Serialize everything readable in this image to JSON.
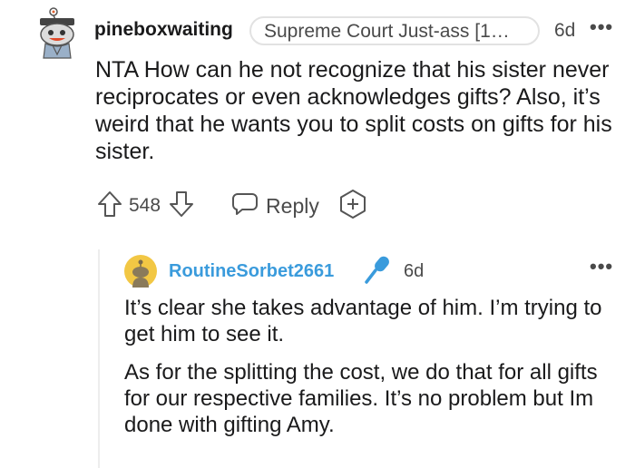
{
  "comment": {
    "username": "pineboxwaiting",
    "flair": "Supreme Court Just-ass [1…",
    "age": "6d",
    "more": "•••",
    "body": "NTA How can he not recognize that his sister never reciprocates or even acknowledges gifts? Also, it’s weird that he wants you to split costs on gifts for his sister.",
    "score": "548",
    "reply_label": "Reply",
    "avatar_icon": "snoo-avatar-icon",
    "upvote_icon": "upvote-arrow-icon",
    "downvote_icon": "downvote-arrow-icon",
    "reply_icon": "speech-bubble-icon",
    "award_icon": "plus-award-icon"
  },
  "reply": {
    "username": "RoutineSorbet2661",
    "username_color": "#3a9bdc",
    "op_icon": "microphone-icon",
    "age": "6d",
    "more": "•••",
    "paragraphs": [
      "It’s clear she takes advantage of him. I’m trying to get him to see it.",
      "As for the splitting the cost, we do that for all gifts for our respective families. It’s no problem but Im done with gifting Amy."
    ]
  }
}
